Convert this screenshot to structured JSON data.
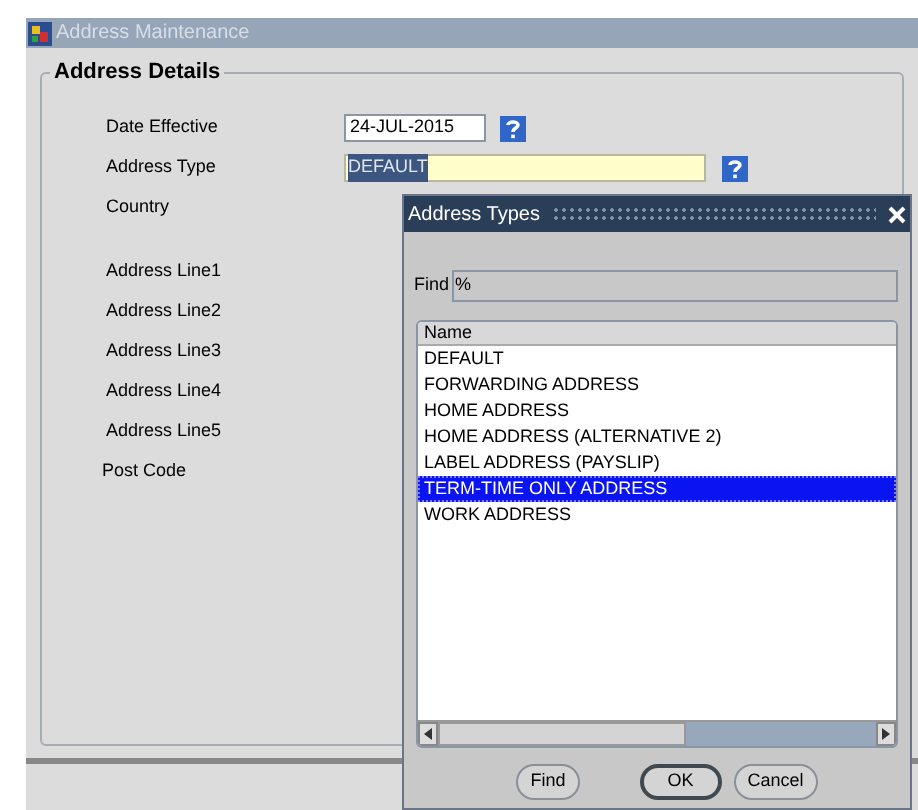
{
  "window": {
    "title": "Address Maintenance"
  },
  "panel": {
    "title": "Address Details"
  },
  "fields": [
    {
      "label": "Date Effective",
      "value": "24-JUL-2015",
      "kind": "date"
    },
    {
      "label": "Address Type",
      "value": "DEFAULT",
      "kind": "lov"
    },
    {
      "label": "Country",
      "kind": "hidden"
    }
  ],
  "address_fields": [
    {
      "label": "Address Line1"
    },
    {
      "label": "Address Line2"
    },
    {
      "label": "Address Line3"
    },
    {
      "label": "Address Line4"
    },
    {
      "label": "Address Line5"
    },
    {
      "label": "Post Code"
    }
  ],
  "dialog": {
    "title": "Address Types",
    "find_label": "Find",
    "find_value": "%",
    "column": "Name",
    "rows": [
      {
        "name": "DEFAULT",
        "selected": false
      },
      {
        "name": "FORWARDING ADDRESS",
        "selected": false
      },
      {
        "name": "HOME ADDRESS",
        "selected": false
      },
      {
        "name": "HOME ADDRESS (ALTERNATIVE 2)",
        "selected": false
      },
      {
        "name": "LABEL ADDRESS (PAYSLIP)",
        "selected": false
      },
      {
        "name": "TERM-TIME ONLY ADDRESS",
        "selected": true
      },
      {
        "name": "WORK ADDRESS",
        "selected": false
      }
    ],
    "buttons": [
      {
        "label": "Find",
        "kind": "normal"
      },
      {
        "label": "OK",
        "kind": "default"
      },
      {
        "label": "Cancel",
        "kind": "normal"
      }
    ]
  }
}
